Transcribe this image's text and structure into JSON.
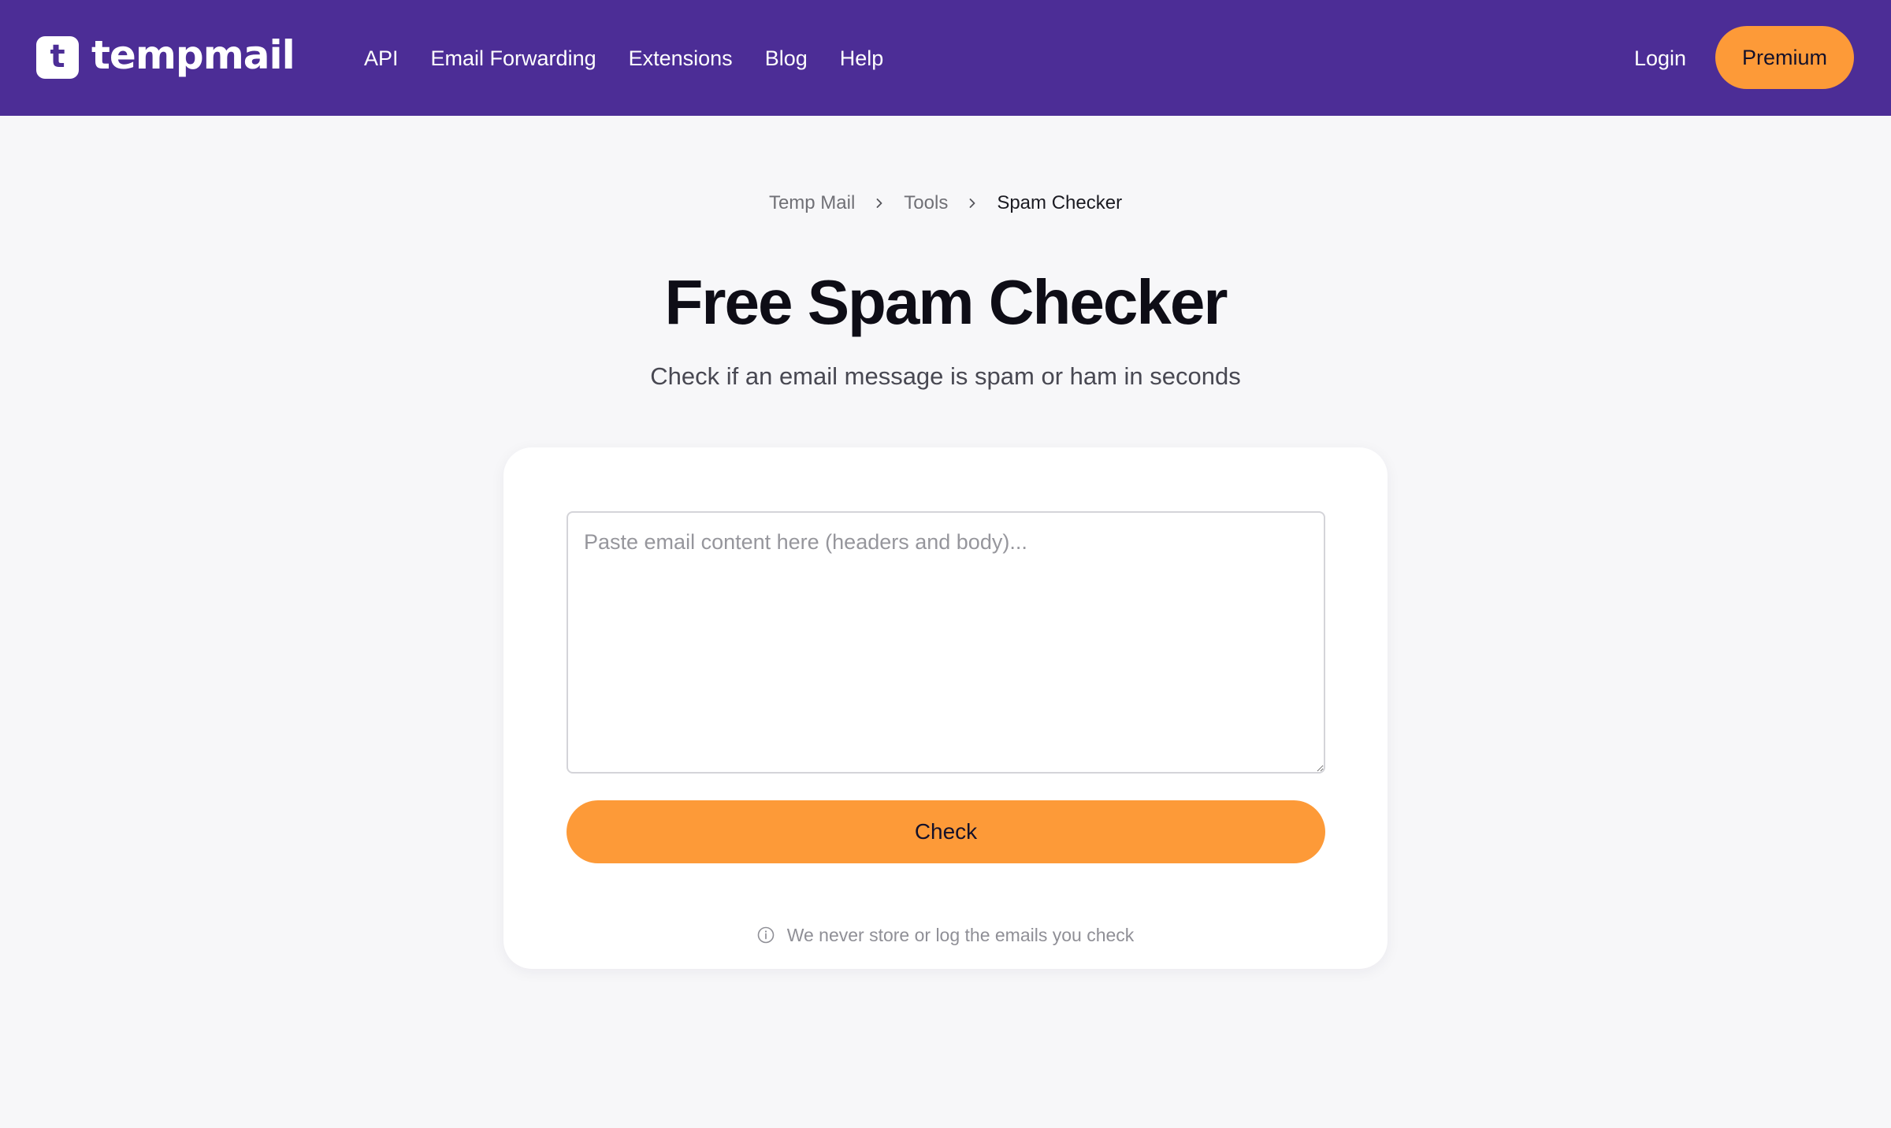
{
  "header": {
    "brand": {
      "badge_letter": "t",
      "name": "tempmail"
    },
    "nav": [
      "API",
      "Email Forwarding",
      "Extensions",
      "Blog",
      "Help"
    ],
    "login_label": "Login",
    "premium_label": "Premium",
    "colors": {
      "background": "#4c2d96",
      "accent": "#fd9a38"
    }
  },
  "breadcrumb": {
    "items": [
      "Temp Mail",
      "Tools"
    ],
    "current": "Spam Checker"
  },
  "main": {
    "title": "Free Spam Checker",
    "subtitle": "Check if an email message is spam or ham in seconds"
  },
  "checker": {
    "textarea_value": "",
    "textarea_placeholder": "Paste email content here (headers and body)...",
    "check_label": "Check",
    "privacy_note": "We never store or log the emails you check"
  }
}
